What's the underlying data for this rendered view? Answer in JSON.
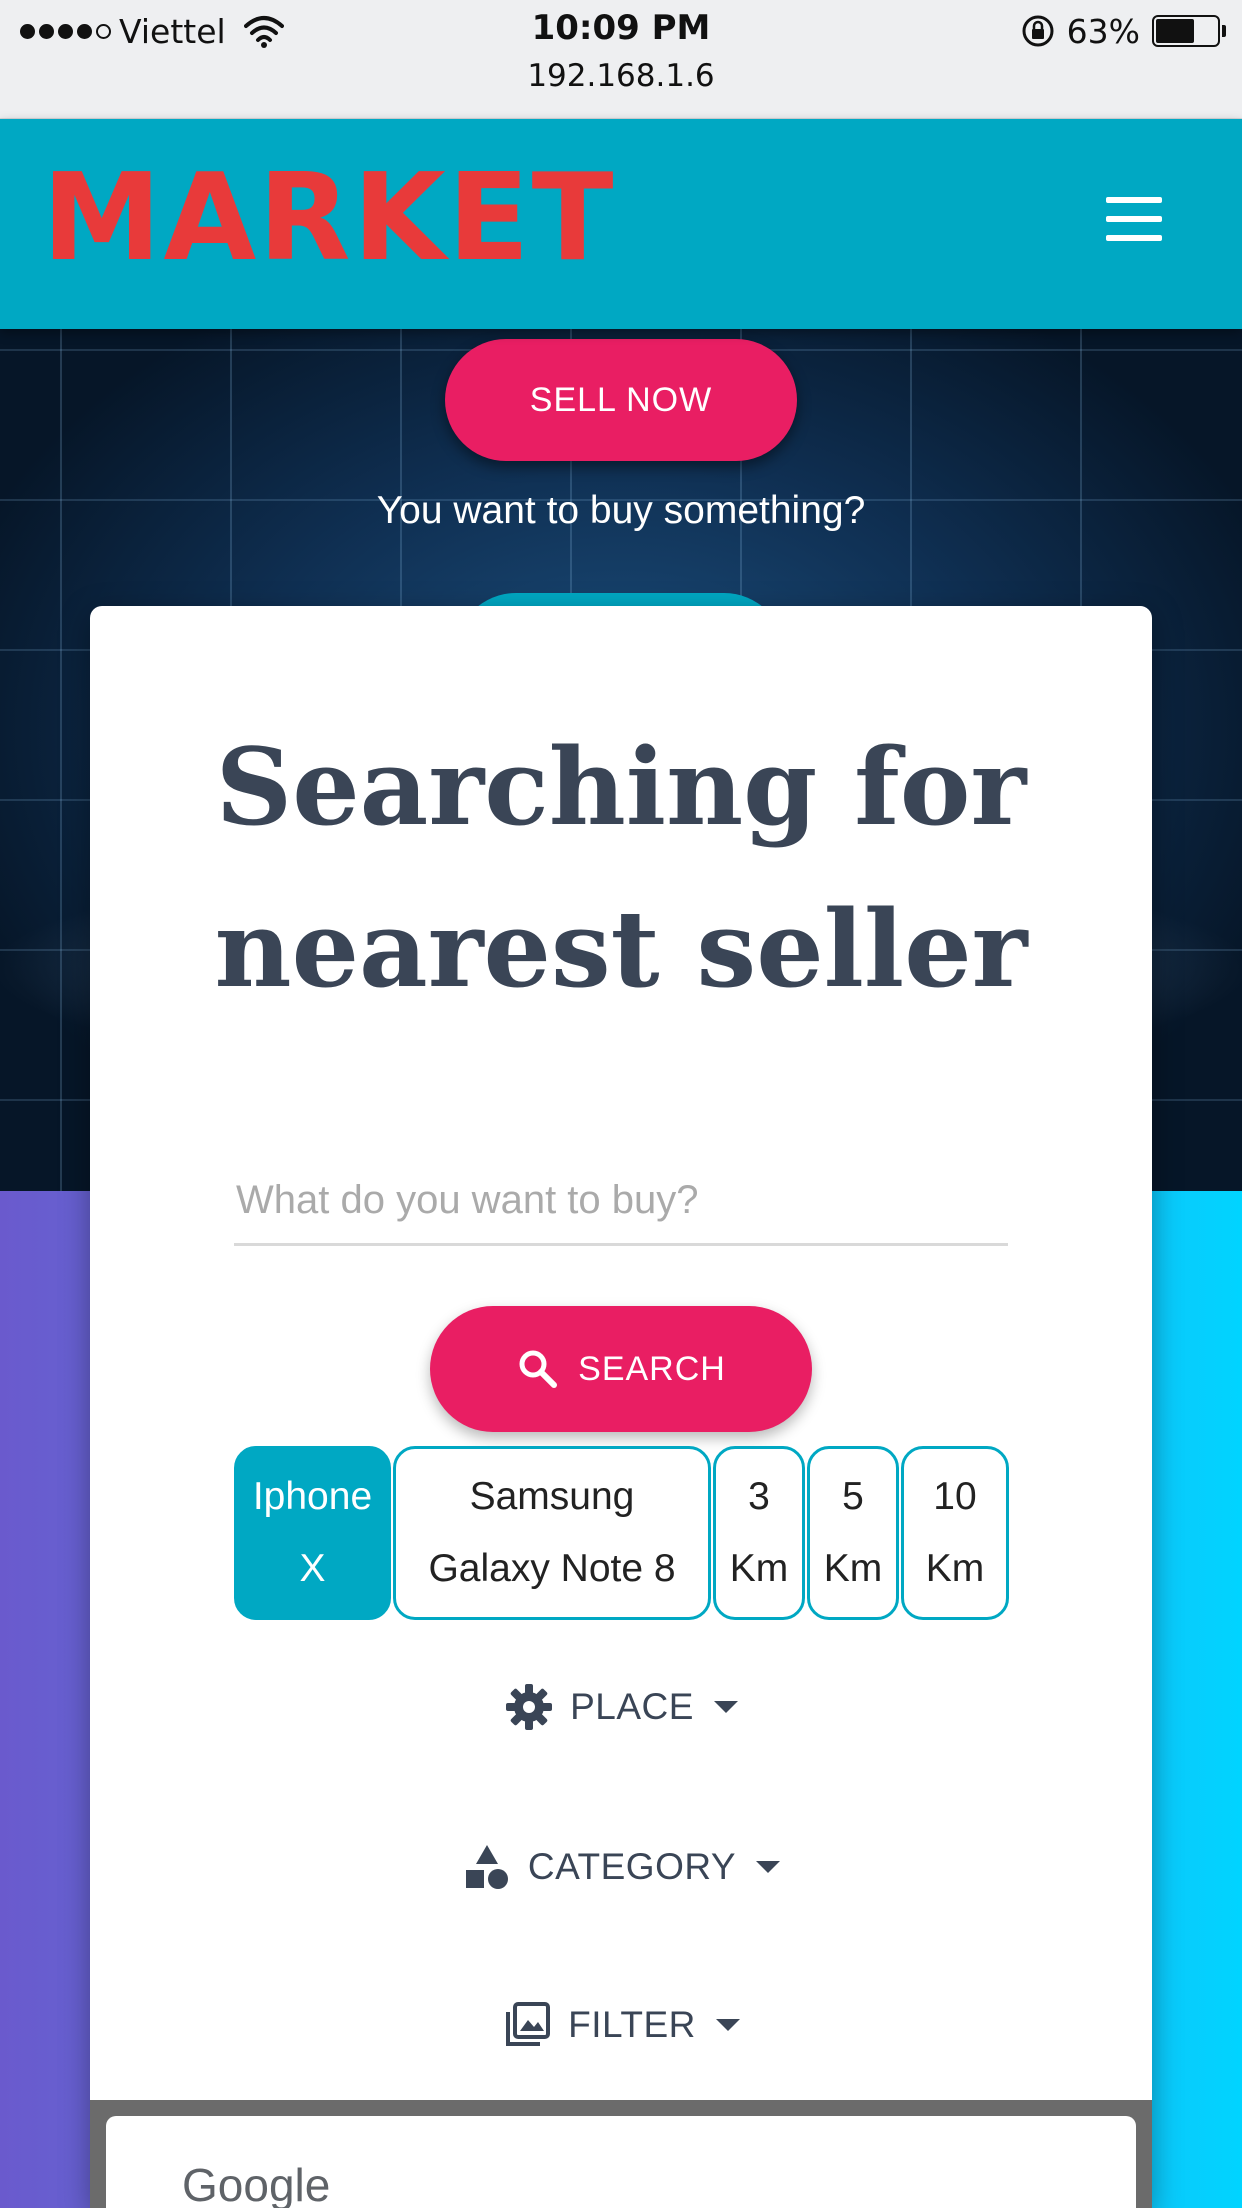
{
  "status_bar": {
    "carrier": "Viettel",
    "time": "10:09 PM",
    "url": "192.168.1.6",
    "battery": "63%",
    "battery_level": 0.63
  },
  "header": {
    "logo": "MARKET",
    "menu_icon": "hamburger-menu-icon"
  },
  "hero": {
    "sell_button": "SELL NOW",
    "prompt": "You want to buy something?"
  },
  "card": {
    "title_line1": "Searching for",
    "title_line2": "nearest seller",
    "search_placeholder": "What do you want to buy?",
    "search_button": "SEARCH",
    "chips": [
      {
        "line1": "Iphone",
        "line2": "X",
        "active": true
      },
      {
        "line1": "Samsung",
        "line2": "Galaxy Note 8",
        "active": false
      },
      {
        "line1": "3",
        "line2": "Km",
        "active": false
      },
      {
        "line1": "5",
        "line2": "Km",
        "active": false
      },
      {
        "line1": "10",
        "line2": "Km",
        "active": false
      }
    ],
    "dropdowns": {
      "place": "PLACE",
      "category": "CATEGORY",
      "filter": "FILTER"
    }
  },
  "map": {
    "brand": "Google"
  },
  "colors": {
    "teal": "#00a8c3",
    "pink": "#e91e63",
    "logo_red": "#e83a3a",
    "title_slate": "#3a4556"
  }
}
